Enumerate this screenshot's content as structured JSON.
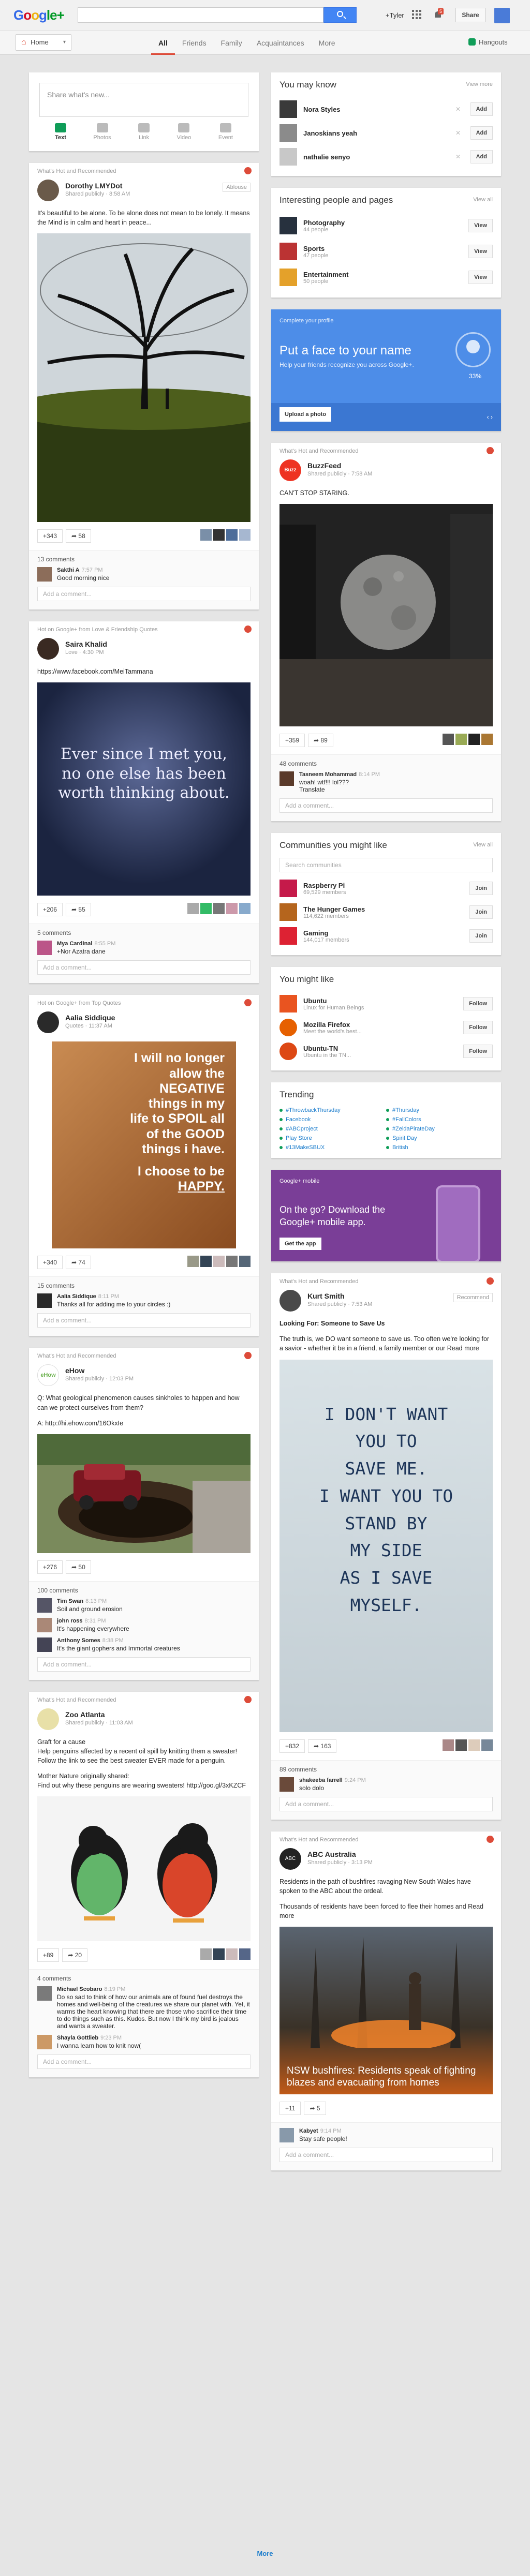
{
  "header": {
    "logo_letters": [
      "G",
      "o",
      "o",
      "g",
      "le+"
    ],
    "search_placeholder": "",
    "user_label": "+Tyler",
    "notif_count": "5",
    "share_label": "Share",
    "hangouts_label": "Hangouts"
  },
  "nav": {
    "home_label": "Home",
    "tabs": [
      "All",
      "Friends",
      "Family",
      "Acquaintances",
      "More"
    ]
  },
  "sharebox": {
    "placeholder": "Share what's new...",
    "tools": [
      "Text",
      "Photos",
      "Link",
      "Video",
      "Event"
    ]
  },
  "posts": [
    {
      "source": "What's Hot and Recommended",
      "author": "Dorothy LMYDot",
      "meta": "Shared publicly · 8:58 AM",
      "badge": "Ablouse",
      "text": "It's beautiful to be alone. To be alone does not mean to be lonely. It means the Mind is in calm and heart in peace...",
      "plus": "+343",
      "shares": "58",
      "comment_count": "13 comments",
      "comments": [
        {
          "name": "Sakthi A",
          "time": "7:57 PM",
          "body": "Good morning nice"
        }
      ],
      "add_comment": "Add a comment..."
    },
    {
      "source": "Hot on Google+ from Love & Friendship Quotes",
      "author": "Saira Khalid",
      "meta": "Love · 4:30 PM",
      "text": "https://www.facebook.com/MeiTammana",
      "quote": "Ever since I met you, no one else has been worth thinking about.",
      "plus": "+206",
      "shares": "55",
      "comment_count": "5 comments",
      "comments": [
        {
          "name": "Mya Cardinal",
          "time": "8:55 PM",
          "body": "+Nor Azatra dane"
        }
      ],
      "add_comment": "Add a comment..."
    },
    {
      "source": "Hot on Google+ from Top Quotes",
      "author": "Aalia Siddique",
      "meta": "Quotes · 11:37 AM",
      "quote_lines": [
        "I will no longer",
        "allow the",
        "NEGATIVE",
        "things in my",
        "life to SPOIL all",
        "of the GOOD",
        "things i have.",
        "I choose to be",
        "HAPPY."
      ],
      "plus": "+340",
      "shares": "74",
      "comment_count": "15 comments",
      "comments": [
        {
          "name": "Aalia Siddique",
          "time": "8:11 PM",
          "body": "Thanks all for adding me to your circles :)"
        }
      ],
      "add_comment": "Add a comment..."
    },
    {
      "source": "What's Hot and Recommended",
      "author": "eHow",
      "meta": "Shared publicly · 12:03 PM",
      "text": "Q: What geological phenomenon causes sinkholes to happen and how can we protect ourselves from them?",
      "link": "A: http://hi.ehow.com/16OkxIe",
      "plus": "+276",
      "shares": "50",
      "comment_count": "100 comments",
      "comments": [
        {
          "name": "Tim Swan",
          "time": "8:13 PM",
          "body": "Soil and ground erosion"
        },
        {
          "name": "john ross",
          "time": "8:31 PM",
          "body": "It's happening everywhere"
        },
        {
          "name": "Anthony Somes",
          "time": "8:38 PM",
          "body": "It's the giant gophers and Immortal creatures"
        }
      ],
      "add_comment": "Add a comment..."
    },
    {
      "source": "What's Hot and Recommended",
      "author": "Zoo Atlanta",
      "meta": "Shared publicly · 11:03 AM",
      "text": "Graft for a cause\nHelp penguins affected by a recent oil spill by knitting them a sweater! Follow the link to see the best sweater EVER made for a penguin.",
      "text2": "Mother Nature originally shared:\nFind out why these penguins are wearing sweaters! http://goo.gl/3xKZCF",
      "plus": "+89",
      "shares": "20",
      "comment_count": "4 comments",
      "comments": [
        {
          "name": "Michael Scobaro",
          "time": "8:19 PM",
          "body": "Do so sad to think of how our animals are of found fuel destroys the homes and well-being of the creatures we share our planet with. Yet, it warms the heart knowing that there are those who sacrifice their time to do things such as this. Kudos. But now I think my bird is jealous and wants a sweater."
        },
        {
          "name": "Shayla Gottlieb",
          "time": "9:23 PM",
          "body": "I wanna learn how to knit now("
        }
      ],
      "add_comment": "Add a comment..."
    }
  ],
  "right_posts": [
    {
      "source": "What's Hot and Recommended",
      "author": "BuzzFeed",
      "meta": "Shared publicly · 7:58 AM",
      "text": "CAN'T STOP STARING.",
      "plus": "+359",
      "shares": "89",
      "comment_count": "48 comments",
      "comments": [
        {
          "name": "Tasneem Mohammad",
          "time": "8:14 PM",
          "body": "woah! wtf!!! lol???\nTranslate"
        }
      ],
      "add_comment": "Add a comment..."
    },
    {
      "source": "What's Hot and Recommended",
      "author": "Kurt Smith",
      "meta": "Shared publicly · 7:53 AM",
      "badge": "Recommend",
      "text": "Looking For: Someone to Save Us",
      "text2": "The truth is, we DO want someone to save us. Too often we're looking for a savior - whether it be in a friend, a family member or our Read more",
      "handwriting": [
        "I DON'T WANT",
        "YOU TO",
        "SAVE ME.",
        "I WANT YOU TO",
        "STAND BY",
        "MY SIDE",
        "AS I SAVE",
        "MYSELF."
      ],
      "plus": "+832",
      "shares": "163",
      "comment_count": "89 comments",
      "comments": [
        {
          "name": "shakeeba farrell",
          "time": "9:24 PM",
          "body": "solo dolo"
        }
      ],
      "add_comment": "Add a comment..."
    },
    {
      "source": "What's Hot and Recommended",
      "author": "ABC Australia",
      "meta": "Shared publicly · 3:13 PM",
      "text": "Residents in the path of bushfires ravaging New South Wales have spoken to the ABC about the ordeal.",
      "text2": "Thousands of residents have been forced to flee their homes and Read more",
      "caption": "NSW bushfires: Residents speak of fighting blazes and evacuating from homes",
      "plus": "+11",
      "shares": "5",
      "comment_count": "",
      "comments": [
        {
          "name": "Kabyet",
          "time": "9:14 PM",
          "body": "Stay safe people!"
        }
      ],
      "add_comment": "Add a comment..."
    }
  ],
  "you_may_know": {
    "title": "You may know",
    "view_more": "View more",
    "people": [
      {
        "name": "Nora Styles",
        "sub": ""
      },
      {
        "name": "Janoskians yeah",
        "sub": ""
      },
      {
        "name": "nathalie senyo",
        "sub": ""
      }
    ],
    "add_label": "Add"
  },
  "interesting": {
    "title": "Interesting people and pages",
    "view_all": "View all",
    "items": [
      {
        "name": "Photography",
        "sub": "44 people"
      },
      {
        "name": "Sports",
        "sub": "47 people"
      },
      {
        "name": "Entertainment",
        "sub": "50 people"
      }
    ],
    "view_label": "View"
  },
  "profile": {
    "label": "Complete your profile",
    "title": "Put a face to your name",
    "sub": "Help your friends recognize you across Google+.",
    "pct": "33%",
    "button": "Upload a photo"
  },
  "communities": {
    "title": "Communities you might like",
    "view_all": "View all",
    "search": "Search communities",
    "items": [
      {
        "name": "Raspberry Pi",
        "sub": "69,529 members"
      },
      {
        "name": "The Hunger Games",
        "sub": "114,622 members"
      },
      {
        "name": "Gaming",
        "sub": "144,017 members"
      }
    ],
    "join_label": "Join"
  },
  "might_like": {
    "title": "You might like",
    "items": [
      {
        "name": "Ubuntu",
        "sub": "Linux for Human Beings"
      },
      {
        "name": "Mozilla Firefox",
        "sub": "Meet the world's best..."
      },
      {
        "name": "Ubuntu-TN",
        "sub": "Ubuntu in the TN..."
      }
    ],
    "follow_label": "Follow"
  },
  "trending": {
    "title": "Trending",
    "items": [
      "#ThrowbackThursday",
      "#Thursday",
      "Facebook",
      "#FallColors",
      "#ABCproject",
      "#ZeldaPirateDay",
      "Play Store",
      "Spirit Day",
      "#13MakeSBUX",
      "British"
    ]
  },
  "mobile": {
    "label": "Google+ mobile",
    "text": "On the go? Download the Google+ mobile app.",
    "button": "Get the app"
  },
  "footer": {
    "more": "More"
  }
}
